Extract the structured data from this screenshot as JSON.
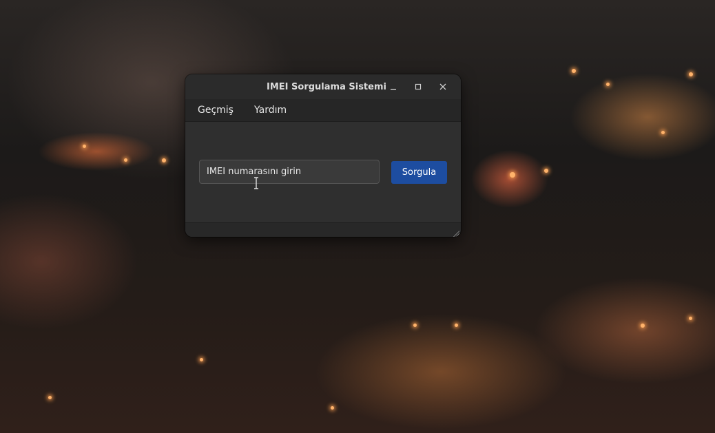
{
  "window": {
    "title": "IMEI Sorgulama Sistemi",
    "controls": {
      "minimize": "—",
      "maximize": "□",
      "close": "✕"
    }
  },
  "menu": {
    "items": [
      {
        "label": "Geçmiş"
      },
      {
        "label": "Yardım"
      }
    ]
  },
  "form": {
    "imei_input": {
      "placeholder": "IMEI numarasını girin",
      "value": ""
    },
    "query_button_label": "Sorgula"
  },
  "colors": {
    "accent": "#1d4da0",
    "window_bg": "#2f2f2f"
  },
  "icons": {
    "minimize": "minimize-icon",
    "maximize": "maximize-icon",
    "close": "close-icon",
    "cursor": "text-cursor-icon"
  }
}
